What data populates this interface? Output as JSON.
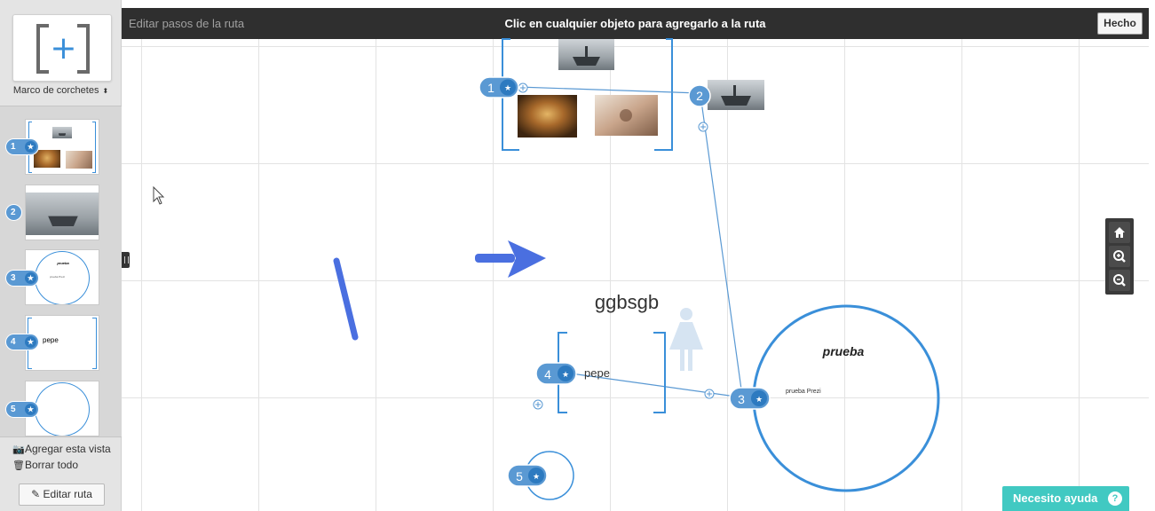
{
  "sidebar": {
    "frame_type_label": "Marco de corchetes",
    "frame_picker_symbol": "+",
    "caret": "⬍",
    "thumbnails": [
      {
        "number": "1",
        "type": "bracket-frame-images"
      },
      {
        "number": "2",
        "type": "ship-image"
      },
      {
        "number": "3",
        "type": "circle-frame",
        "title": "prueba",
        "subtitle": "prueba Prezi"
      },
      {
        "number": "4",
        "type": "bracket-frame",
        "text": "pepe"
      },
      {
        "number": "5",
        "type": "circle-frame"
      }
    ],
    "add_view_label": "Agregar esta vista",
    "clear_all_label": "Borrar todo",
    "edit_route_label": "Editar ruta",
    "camera_icon": "📷",
    "trash_icon": "🗑",
    "pencil_icon": "✎",
    "star_icon": "★"
  },
  "topbar": {
    "title": "Editar pasos de la ruta",
    "instruction": "Clic en cualquier objeto para agregarlo a la ruta",
    "done_label": "Hecho"
  },
  "canvas": {
    "heading_text": "ggbsgb",
    "circle_title": "prueba",
    "circle_subtitle": "prueba Prezi",
    "bracket_text": "pepe",
    "path_points": [
      {
        "number": "1"
      },
      {
        "number": "2"
      },
      {
        "number": "3"
      },
      {
        "number": "4"
      },
      {
        "number": "5"
      }
    ]
  },
  "zoom": {
    "home_icon": "home-icon",
    "zoom_in_icon": "zoom-in-icon",
    "zoom_out_icon": "zoom-out-icon"
  },
  "help": {
    "label": "Necesito ayuda",
    "icon": "?"
  },
  "colors": {
    "accent": "#3a8fd9",
    "badge": "#5a99d3",
    "badge_star": "#2d7ac0",
    "topbar": "#2f2f2f",
    "help": "#41c9c2",
    "arrow": "#4a6fe0"
  }
}
